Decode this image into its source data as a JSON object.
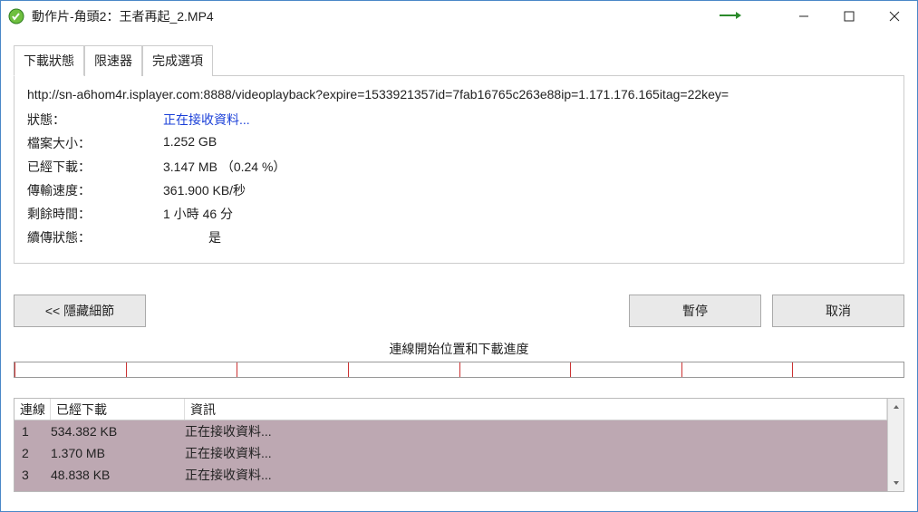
{
  "titlebar": {
    "title": "動作片-角頭2：王者再起_2.MP4"
  },
  "tabs": {
    "status": "下載狀態",
    "limiter": "限速器",
    "complete": "完成選項"
  },
  "url": "http://sn-a6hom4r.isplayer.com:8888/videoplayback?expire=1533921357id=7fab16765c263e88ip=1.171.176.165itag=22key=",
  "stats": {
    "status_label": "狀態：",
    "status_value": "正在接收資料...",
    "filesize_label": "檔案大小：",
    "filesize_value": "1.252  GB",
    "downloaded_label": "已經下載：",
    "downloaded_value": "3.147  MB （0.24 %）",
    "speed_label": "傳輸速度：",
    "speed_value": "361.900  KB/秒",
    "remaining_label": "剩餘時間：",
    "remaining_value": "1 小時 46 分",
    "resume_label": "續傳狀態：",
    "resume_value": "是"
  },
  "buttons": {
    "hide": "<< 隱藏細節",
    "pause": "暫停",
    "cancel": "取消"
  },
  "progress_caption": "連線開始位置和下載進度",
  "progress_segments_pct": [
    0,
    12.5,
    25,
    37.5,
    50,
    62.5,
    75,
    87.5
  ],
  "grid": {
    "headers": {
      "n": "連線",
      "dl": "已經下載",
      "info": "資訊"
    },
    "rows": [
      {
        "n": "1",
        "dl": "534.382  KB",
        "info": "正在接收資料..."
      },
      {
        "n": "2",
        "dl": "1.370  MB",
        "info": "正在接收資料..."
      },
      {
        "n": "3",
        "dl": "48.838  KB",
        "info": "正在接收資料..."
      }
    ]
  }
}
